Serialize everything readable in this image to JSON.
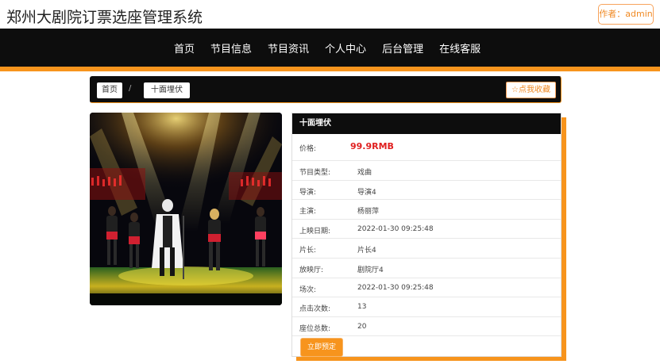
{
  "site": {
    "title": "郑州大剧院订票选座管理系统",
    "author_label": "作者：admin"
  },
  "nav": {
    "items": [
      "首页",
      "节目信息",
      "节目资讯",
      "个人中心",
      "后台管理",
      "在线客服"
    ]
  },
  "breadcrumb": {
    "home": "首页",
    "separator": "/",
    "current": "十面埋伏",
    "favorite_label": "☆点我收藏"
  },
  "program": {
    "name": "十面埋伏",
    "price_label": "价格:",
    "price_value": "99.9RMB",
    "fields": [
      {
        "label": "节目类型:",
        "value": "戏曲"
      },
      {
        "label": "导演:",
        "value": "导演4"
      },
      {
        "label": "主演:",
        "value": "杨丽萍"
      },
      {
        "label": "上映日期:",
        "value": "2022-01-30 09:25:48"
      },
      {
        "label": "片长:",
        "value": "片长4"
      },
      {
        "label": "放映厅:",
        "value": "剧院厅4"
      },
      {
        "label": "场次:",
        "value": "2022-01-30 09:25:48"
      },
      {
        "label": "点击次数:",
        "value": "13"
      },
      {
        "label": "座位总数:",
        "value": "20"
      }
    ],
    "book_label": "立即预定"
  },
  "colors": {
    "accent": "#f7941d",
    "nav_bg": "#0d0d0d",
    "price": "#e02020"
  }
}
